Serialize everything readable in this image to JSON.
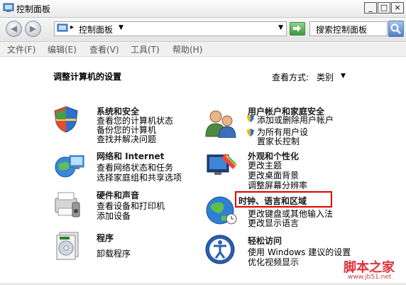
{
  "window": {
    "title": "控制面板",
    "min_label": "_",
    "max_label": "□",
    "close_label": "×"
  },
  "nav": {
    "back_label": "◀",
    "forward_label": "▶",
    "breadcrumb_separator": "▸",
    "breadcrumb": "控制面板",
    "search_placeholder": "搜索控制面板"
  },
  "menu": [
    "文件(F)",
    "编辑(E)",
    "查看(V)",
    "工具(T)",
    "帮助(H)"
  ],
  "main": {
    "heading": "调整计算机的设置",
    "view_by_label": "查看方式:",
    "view_by_value": "类别"
  },
  "categories": [
    {
      "title": "系统和安全",
      "icon": "system-security-icon",
      "links": [
        "查看您的计算机状态",
        "备份您的计算机",
        "查找并解决问题"
      ]
    },
    {
      "title": "网络和 Internet",
      "icon": "network-icon",
      "links": [
        "查看网络状态和任务",
        "选择家庭组和共享选项"
      ]
    },
    {
      "title": "硬件和声音",
      "icon": "hardware-sound-icon",
      "links": [
        "查看设备和打印机",
        "添加设备"
      ]
    },
    {
      "title": "程序",
      "icon": "programs-icon",
      "links": [
        "卸载程序"
      ]
    },
    {
      "title": "用户帐户和家庭安全",
      "icon": "user-accounts-icon",
      "links": [
        "添加或删除用户帐户",
        "为所有用户设置家长控制"
      ]
    },
    {
      "title": "外观和个性化",
      "icon": "appearance-icon",
      "links": [
        "更改主题",
        "更改桌面背景",
        "调整屏幕分辨率"
      ]
    },
    {
      "title": "时钟、语言和区域",
      "icon": "clock-region-icon",
      "links": [
        "更改键盘或其他输入法",
        "更改显示语言"
      ]
    },
    {
      "title": "轻松访问",
      "icon": "ease-of-access-icon",
      "links": [
        "使用 Windows 建议的设置",
        "优化视频显示"
      ]
    }
  ],
  "watermark": {
    "brand": "脚本之家",
    "url": "www.jb51.net"
  },
  "colors": {
    "highlight": "#e00000",
    "watermark": "#e0303a"
  }
}
